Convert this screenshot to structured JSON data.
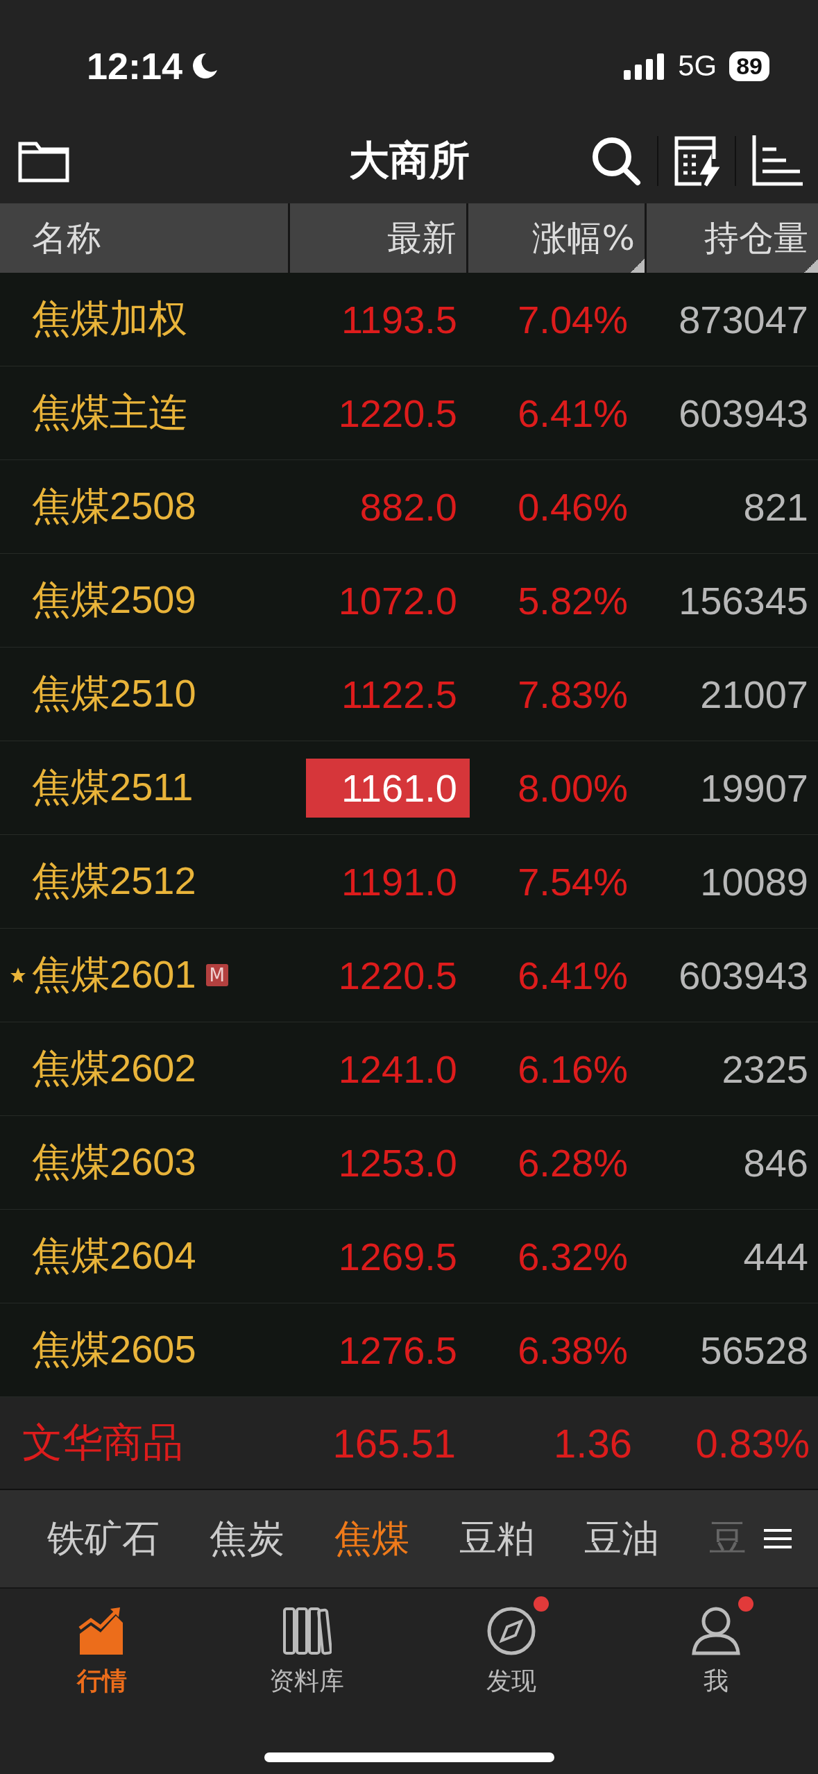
{
  "status_bar": {
    "time": "12:14",
    "network": "5G",
    "battery": "89"
  },
  "header": {
    "title": "大商所"
  },
  "table": {
    "columns": [
      {
        "label": "名称",
        "sortable": false
      },
      {
        "label": "最新",
        "sortable": false
      },
      {
        "label": "涨幅%",
        "sortable": true
      },
      {
        "label": "持仓量",
        "sortable": true
      }
    ],
    "rows": [
      {
        "name": "焦煤加权",
        "starred": false,
        "price": "1193.5",
        "flash": false,
        "change": "7.04%",
        "open_interest": "873047"
      },
      {
        "name": "焦煤主连",
        "starred": false,
        "price": "1220.5",
        "flash": false,
        "change": "6.41%",
        "open_interest": "603943"
      },
      {
        "name": "焦煤2508",
        "starred": false,
        "price": "882.0",
        "flash": false,
        "change": "0.46%",
        "open_interest": "821"
      },
      {
        "name": "焦煤2509",
        "starred": false,
        "price": "1072.0",
        "flash": false,
        "change": "5.82%",
        "open_interest": "156345"
      },
      {
        "name": "焦煤2510",
        "starred": false,
        "price": "1122.5",
        "flash": false,
        "change": "7.83%",
        "open_interest": "21007"
      },
      {
        "name": "焦煤2511",
        "starred": false,
        "price": "1161.0",
        "flash": true,
        "change": "8.00%",
        "open_interest": "19907"
      },
      {
        "name": "焦煤2512",
        "starred": false,
        "price": "1191.0",
        "flash": false,
        "change": "7.54%",
        "open_interest": "10089"
      },
      {
        "name": "焦煤2601",
        "starred": true,
        "badge": "M",
        "price": "1220.5",
        "flash": false,
        "change": "6.41%",
        "open_interest": "603943"
      },
      {
        "name": "焦煤2602",
        "starred": false,
        "price": "1241.0",
        "flash": false,
        "change": "6.16%",
        "open_interest": "2325"
      },
      {
        "name": "焦煤2603",
        "starred": false,
        "price": "1253.0",
        "flash": false,
        "change": "6.28%",
        "open_interest": "846"
      },
      {
        "name": "焦煤2604",
        "starred": false,
        "price": "1269.5",
        "flash": false,
        "change": "6.32%",
        "open_interest": "444"
      },
      {
        "name": "焦煤2605",
        "starred": false,
        "price": "1276.5",
        "flash": false,
        "change": "6.38%",
        "open_interest": "56528"
      }
    ]
  },
  "index_row": {
    "name": "文华商品",
    "value": "165.51",
    "change": "1.36",
    "change_percent": "0.83%"
  },
  "category_tabs": [
    {
      "label": "铁矿石",
      "selected": false
    },
    {
      "label": "焦炭",
      "selected": false
    },
    {
      "label": "焦煤",
      "selected": true
    },
    {
      "label": "豆粕",
      "selected": false
    },
    {
      "label": "豆油",
      "selected": false
    },
    {
      "label": "豆",
      "selected": false
    }
  ],
  "bottom_nav": [
    {
      "kind": "market",
      "label": "行情",
      "selected": true,
      "badge": false
    },
    {
      "kind": "library",
      "label": "资料库",
      "selected": false,
      "badge": false
    },
    {
      "kind": "discover",
      "label": "发现",
      "selected": false,
      "badge": true
    },
    {
      "kind": "me",
      "label": "我",
      "selected": false,
      "badge": true
    }
  ]
}
